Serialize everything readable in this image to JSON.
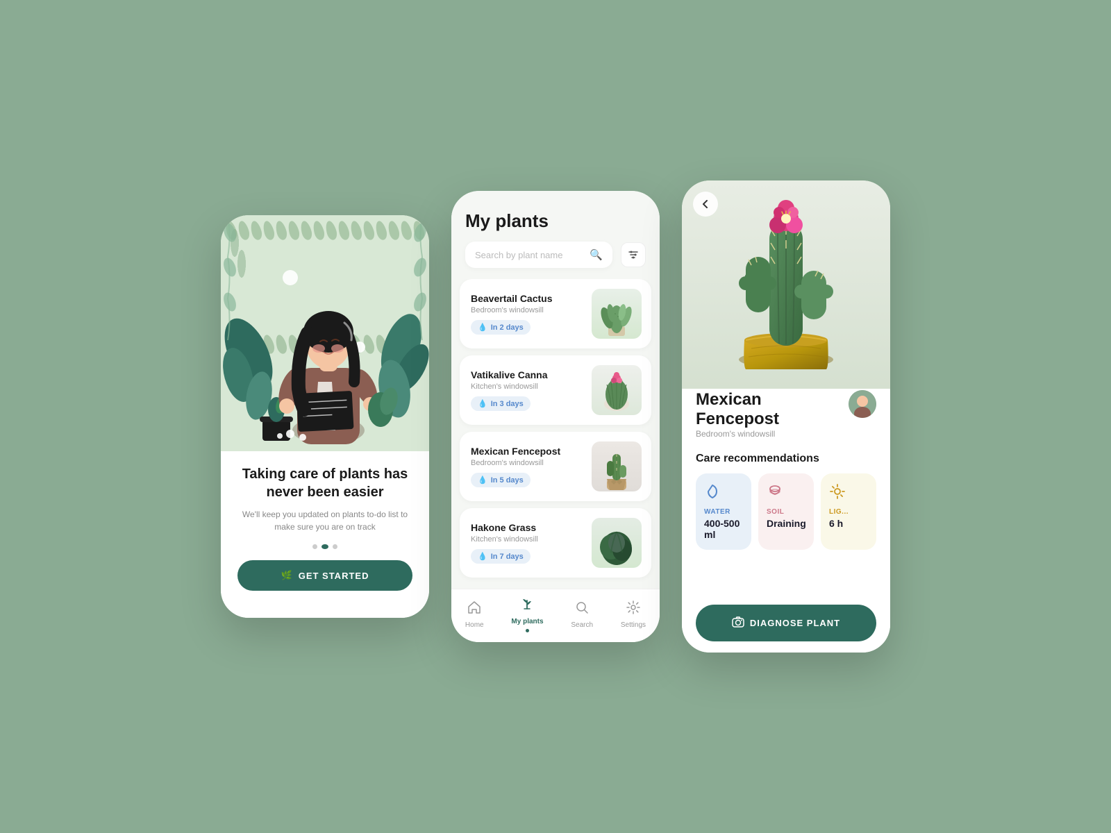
{
  "page": {
    "bg_color": "#8aab93"
  },
  "phone1": {
    "title": "Taking care of plants has never been easier",
    "subtitle": "We'll keep you updated on plants to-do list to make sure you are on track",
    "dots": [
      false,
      true,
      false
    ],
    "cta_label": "GET STARTED",
    "cta_icon": "🌿"
  },
  "phone2": {
    "header_title": "My plants",
    "search_placeholder": "Search by plant name",
    "plants": [
      {
        "name": "Beavertail Cactus",
        "location": "Bedroom's windowsill",
        "water_label": "In 2 days",
        "type": "cactus1"
      },
      {
        "name": "Vatikalive Canna",
        "location": "Kitchen's windowsill",
        "water_label": "In 3 days",
        "type": "cactus2"
      },
      {
        "name": "Mexican Fencepost",
        "location": "Bedroom's windowsill",
        "water_label": "In 5 days",
        "type": "cactus3"
      },
      {
        "name": "Hakone Grass",
        "location": "Kitchen's windowsill",
        "water_label": "In 7 days",
        "type": "grass"
      }
    ],
    "nav": [
      {
        "icon": "🏠",
        "label": "Home",
        "active": false
      },
      {
        "icon": "🌿",
        "label": "My plants",
        "active": true
      },
      {
        "icon": "🔍",
        "label": "Search",
        "active": false
      },
      {
        "icon": "⚙️",
        "label": "Settings",
        "active": false
      }
    ]
  },
  "phone3": {
    "back_icon": "←",
    "plant_name": "Mexican Fencepost",
    "plant_location": "Bedroom's windowsill",
    "care_title": "Care recommendations",
    "water": {
      "label": "WATER",
      "value": "400-500 ml",
      "icon": "💧"
    },
    "soil": {
      "label": "SOIL",
      "value": "Draining",
      "icon": "🟤"
    },
    "light": {
      "label": "LIGHT",
      "value": "6 h",
      "icon": "☀️"
    },
    "diagnose_label": "DIAGNOSE PLANT",
    "diagnose_icon": "📷"
  }
}
